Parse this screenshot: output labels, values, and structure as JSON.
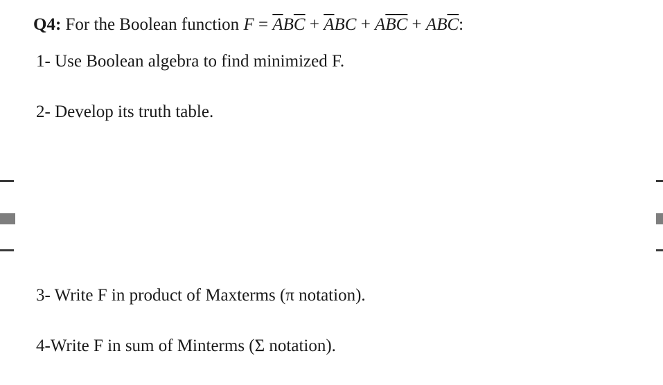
{
  "question": {
    "label": "Q4:",
    "prefix": "For the Boolean function ",
    "func_var": "F",
    "equals": " = ",
    "term1_a": "A",
    "term1_a_bar": true,
    "term1_b": "B",
    "term1_b_bar": false,
    "term1_c": "C",
    "term1_c_bar": true,
    "term2_a": "A",
    "term2_a_bar": true,
    "term2_b": "B",
    "term2_b_bar": false,
    "term2_c": "C",
    "term2_c_bar": false,
    "term3_a": "A",
    "term3_a_bar": false,
    "term3_b": "B",
    "term3_b_bar": true,
    "term3_c": "C",
    "term3_c_bar": true,
    "term4_a": "A",
    "term4_a_bar": false,
    "term4_b": "B",
    "term4_b_bar": false,
    "term4_c": "C",
    "term4_c_bar": true,
    "plus": " + ",
    "colon": ":"
  },
  "parts": {
    "p1": "1- Use Boolean algebra to find minimized F.",
    "p2": "2- Develop its truth table.",
    "p3": "3- Write F in product of  Maxterms (π notation).",
    "p4": "4-Write F in sum of Minterms (Σ notation)."
  }
}
